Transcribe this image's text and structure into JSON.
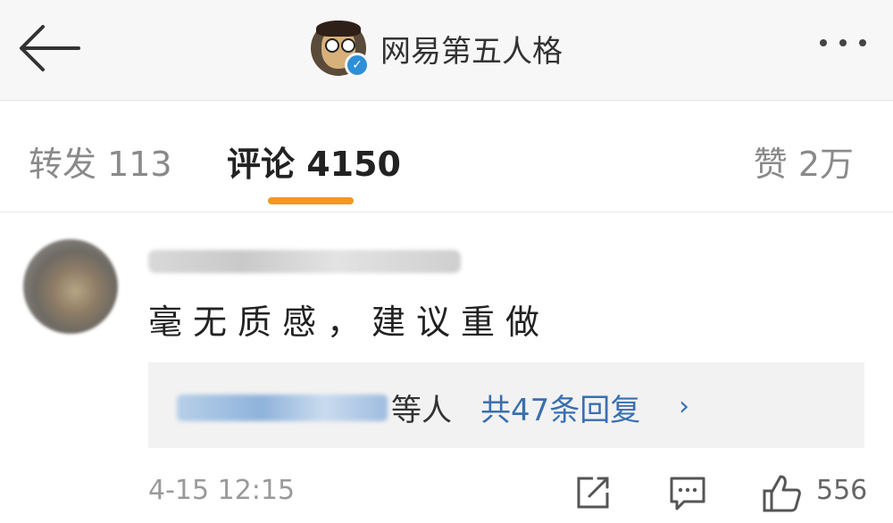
{
  "header": {
    "title": "网易第五人格",
    "verified": true
  },
  "tabs": {
    "repost": "转发 113",
    "comment": "评论 4150",
    "like": "赞 2万",
    "active": "comment"
  },
  "comment": {
    "text": "毫无质感，建议重做",
    "reply_suffix": "等人",
    "reply_total": "共47条回复",
    "time": "4-15 12:15",
    "like_count": "556"
  },
  "colors": {
    "accent": "#f09a1b",
    "link": "#3a6fb0",
    "verified": "#2e8fd8"
  },
  "icons": [
    "back-arrow-icon",
    "more-icon",
    "share-icon",
    "comment-icon",
    "thumbs-up-icon",
    "chevron-right-icon",
    "verified-icon"
  ]
}
